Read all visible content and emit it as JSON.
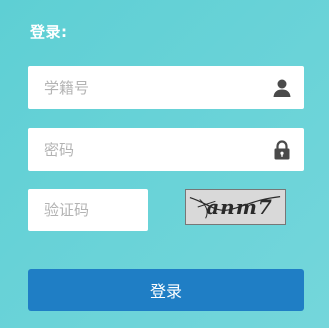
{
  "login": {
    "heading": "登录:",
    "username": {
      "placeholder": "学籍号",
      "value": "",
      "icon": "user-icon"
    },
    "password": {
      "placeholder": "密码",
      "value": "",
      "icon": "lock-icon"
    },
    "captcha": {
      "placeholder": "验证码",
      "value": "",
      "image_text": "anm7"
    },
    "submit_label": "登录"
  },
  "colors": {
    "background": "#65d2d7",
    "button": "#1f7ec5",
    "field": "#ffffff",
    "icon": "#4a4a4a"
  }
}
